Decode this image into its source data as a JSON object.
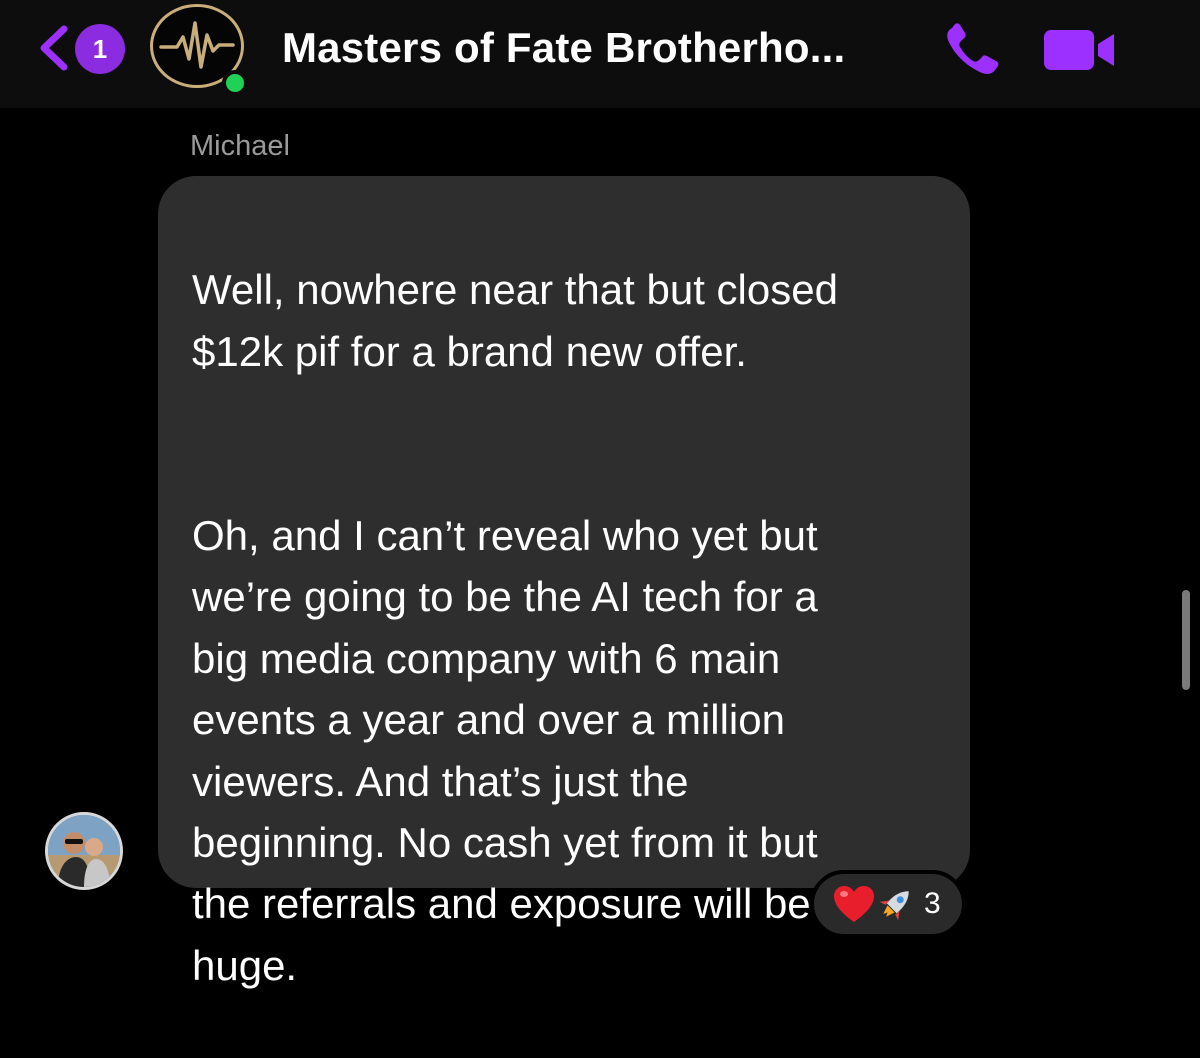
{
  "header": {
    "unread_count": "1",
    "title": "Masters of Fate Brotherho...",
    "accent_color": "#9b30ff",
    "online_color": "#1fd155",
    "icons": [
      "chevron-left-icon",
      "group-logo-waveform",
      "phone-icon",
      "video-camera-icon"
    ]
  },
  "message": {
    "sender": "Michael",
    "paragraph_1": "Well, nowhere near that but closed\n$12k pif for a brand new offer.",
    "paragraph_2": "Oh, and I can’t reveal who yet but\nwe’re going to be the AI tech for a\nbig media company with 6 main\nevents a year and over a million\nviewers. And that’s just the\nbeginning. No cash yet from it but\nthe referrals and exposure will be\nhuge.",
    "bubble_color": "#2e2e2e"
  },
  "reactions": {
    "emojis": [
      "red-heart",
      "rocket"
    ],
    "count": "3"
  }
}
